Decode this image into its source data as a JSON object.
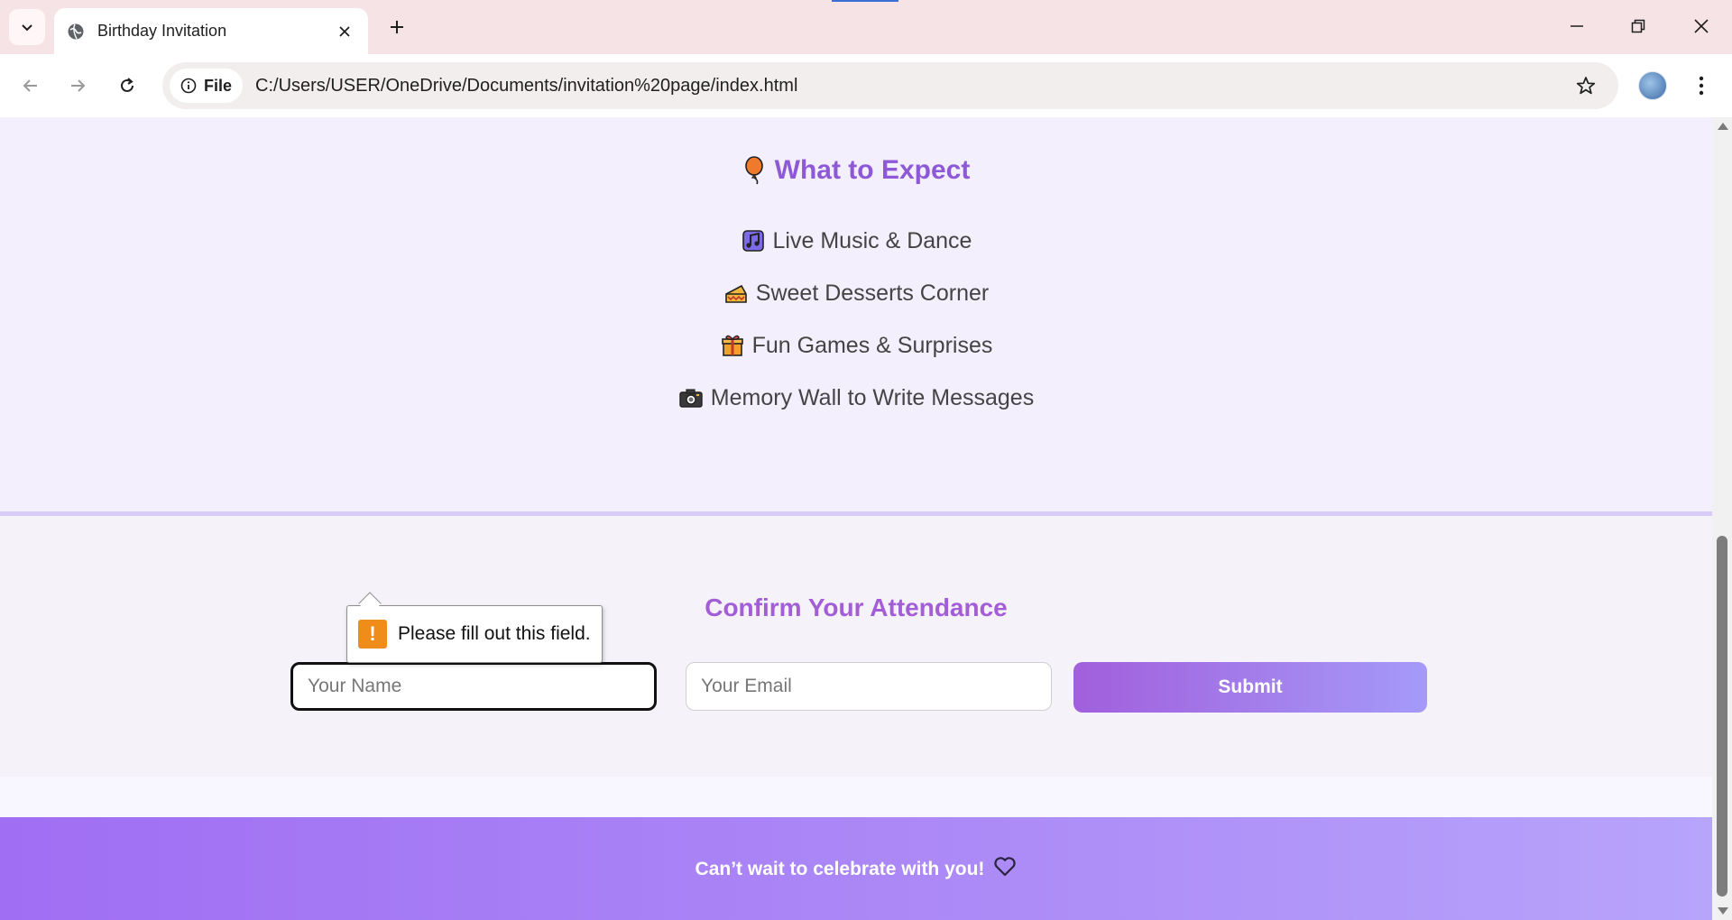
{
  "browser": {
    "tab_title": "Birthday Invitation",
    "site_chip_label": "File",
    "url": "C:/Users/USER/OneDrive/Documents/invitation%20page/index.html"
  },
  "expect": {
    "title": "What to Expect",
    "title_icon": "balloon-icon",
    "items": [
      {
        "icon": "music-notes-icon",
        "label": "Live Music & Dance"
      },
      {
        "icon": "cake-slice-icon",
        "label": "Sweet Desserts Corner"
      },
      {
        "icon": "gift-icon",
        "label": "Fun Games & Surprises"
      },
      {
        "icon": "camera-icon",
        "label": "Memory Wall to Write Messages"
      }
    ]
  },
  "rsvp": {
    "title": "Confirm Your Attendance",
    "name_placeholder": "Your Name",
    "email_placeholder": "Your Email",
    "submit_label": "Submit"
  },
  "validation": {
    "message": "Please fill out this field."
  },
  "footer": {
    "text": "Can’t wait to celebrate with you!",
    "icon": "heart-icon"
  },
  "colors": {
    "heading_purple": "#8e59d6",
    "rsvp_title": "#a35dd6",
    "button_gradient_start": "#a15fdc",
    "button_gradient_end": "#a59af9",
    "footer_gradient_start": "#a06ef3",
    "footer_gradient_end": "#b7a4fb"
  }
}
